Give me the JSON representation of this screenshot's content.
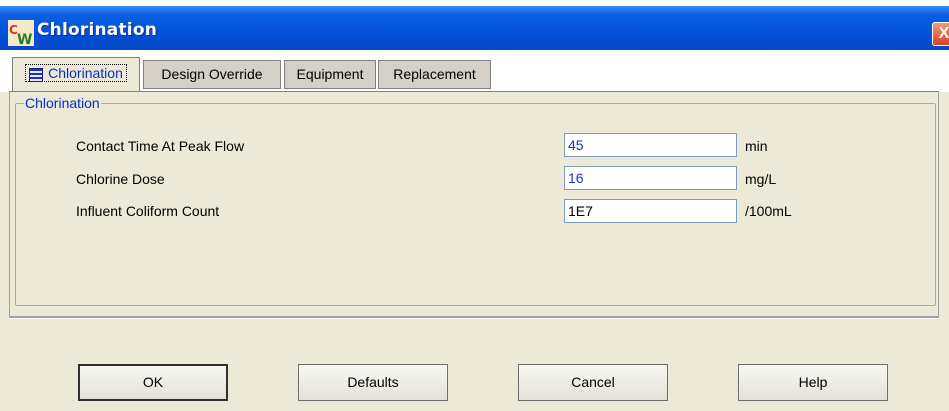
{
  "window": {
    "title": "Chlorination",
    "close_glyph": "X",
    "icon": "cw-app-icon"
  },
  "tabs": [
    {
      "label": "Chlorination",
      "active": true,
      "icon": "list-icon"
    },
    {
      "label": "Design Override",
      "active": false
    },
    {
      "label": "Equipment",
      "active": false
    },
    {
      "label": "Replacement",
      "active": false
    }
  ],
  "group": {
    "label": "Chlorination"
  },
  "fields": [
    {
      "label": "Contact Time At Peak Flow",
      "value": "45",
      "unit": "min",
      "value_color": "#1f2fd0"
    },
    {
      "label": "Chlorine Dose",
      "value": "16",
      "unit": "mg/L",
      "value_color": "#1f2fd0"
    },
    {
      "label": "Influent Coliform Count",
      "value": "1E7",
      "unit": "/100mL",
      "value_color": "#000000"
    }
  ],
  "buttons": {
    "ok": "OK",
    "defaults": "Defaults",
    "cancel": "Cancel",
    "help": "Help"
  },
  "colors": {
    "title_bar": "#0450d6",
    "tab_text_active": "#0b2dc8",
    "group_label": "#0b2dc8"
  }
}
